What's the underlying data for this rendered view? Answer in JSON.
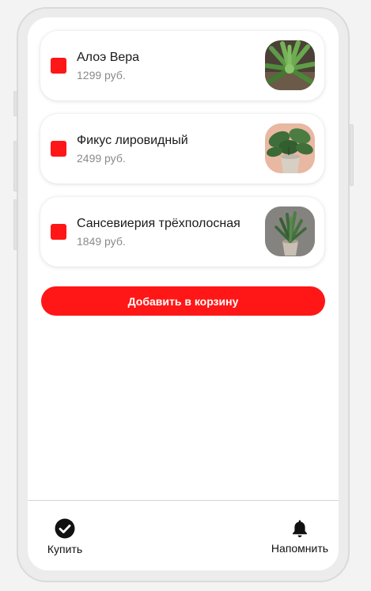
{
  "cart": {
    "items": [
      {
        "name": "Алоэ Вера",
        "price": "1299 руб.",
        "checked": true,
        "image_icon": "aloe-plant-image"
      },
      {
        "name": "Фикус лировидный",
        "price": "2499 руб.",
        "checked": true,
        "image_icon": "ficus-plant-image"
      },
      {
        "name": "Сансевиерия трёхполосная",
        "price": "1849 руб.",
        "checked": true,
        "image_icon": "sansevieria-plant-image"
      }
    ],
    "add_button_label": "Добавить в корзину"
  },
  "bottom_nav": {
    "buy_label": "Купить",
    "buy_icon": "check-circle-icon",
    "remind_label": "Напомнить",
    "remind_icon": "bell-icon"
  },
  "colors": {
    "accent": "#ff1616",
    "price_text": "#8a8a8a"
  }
}
